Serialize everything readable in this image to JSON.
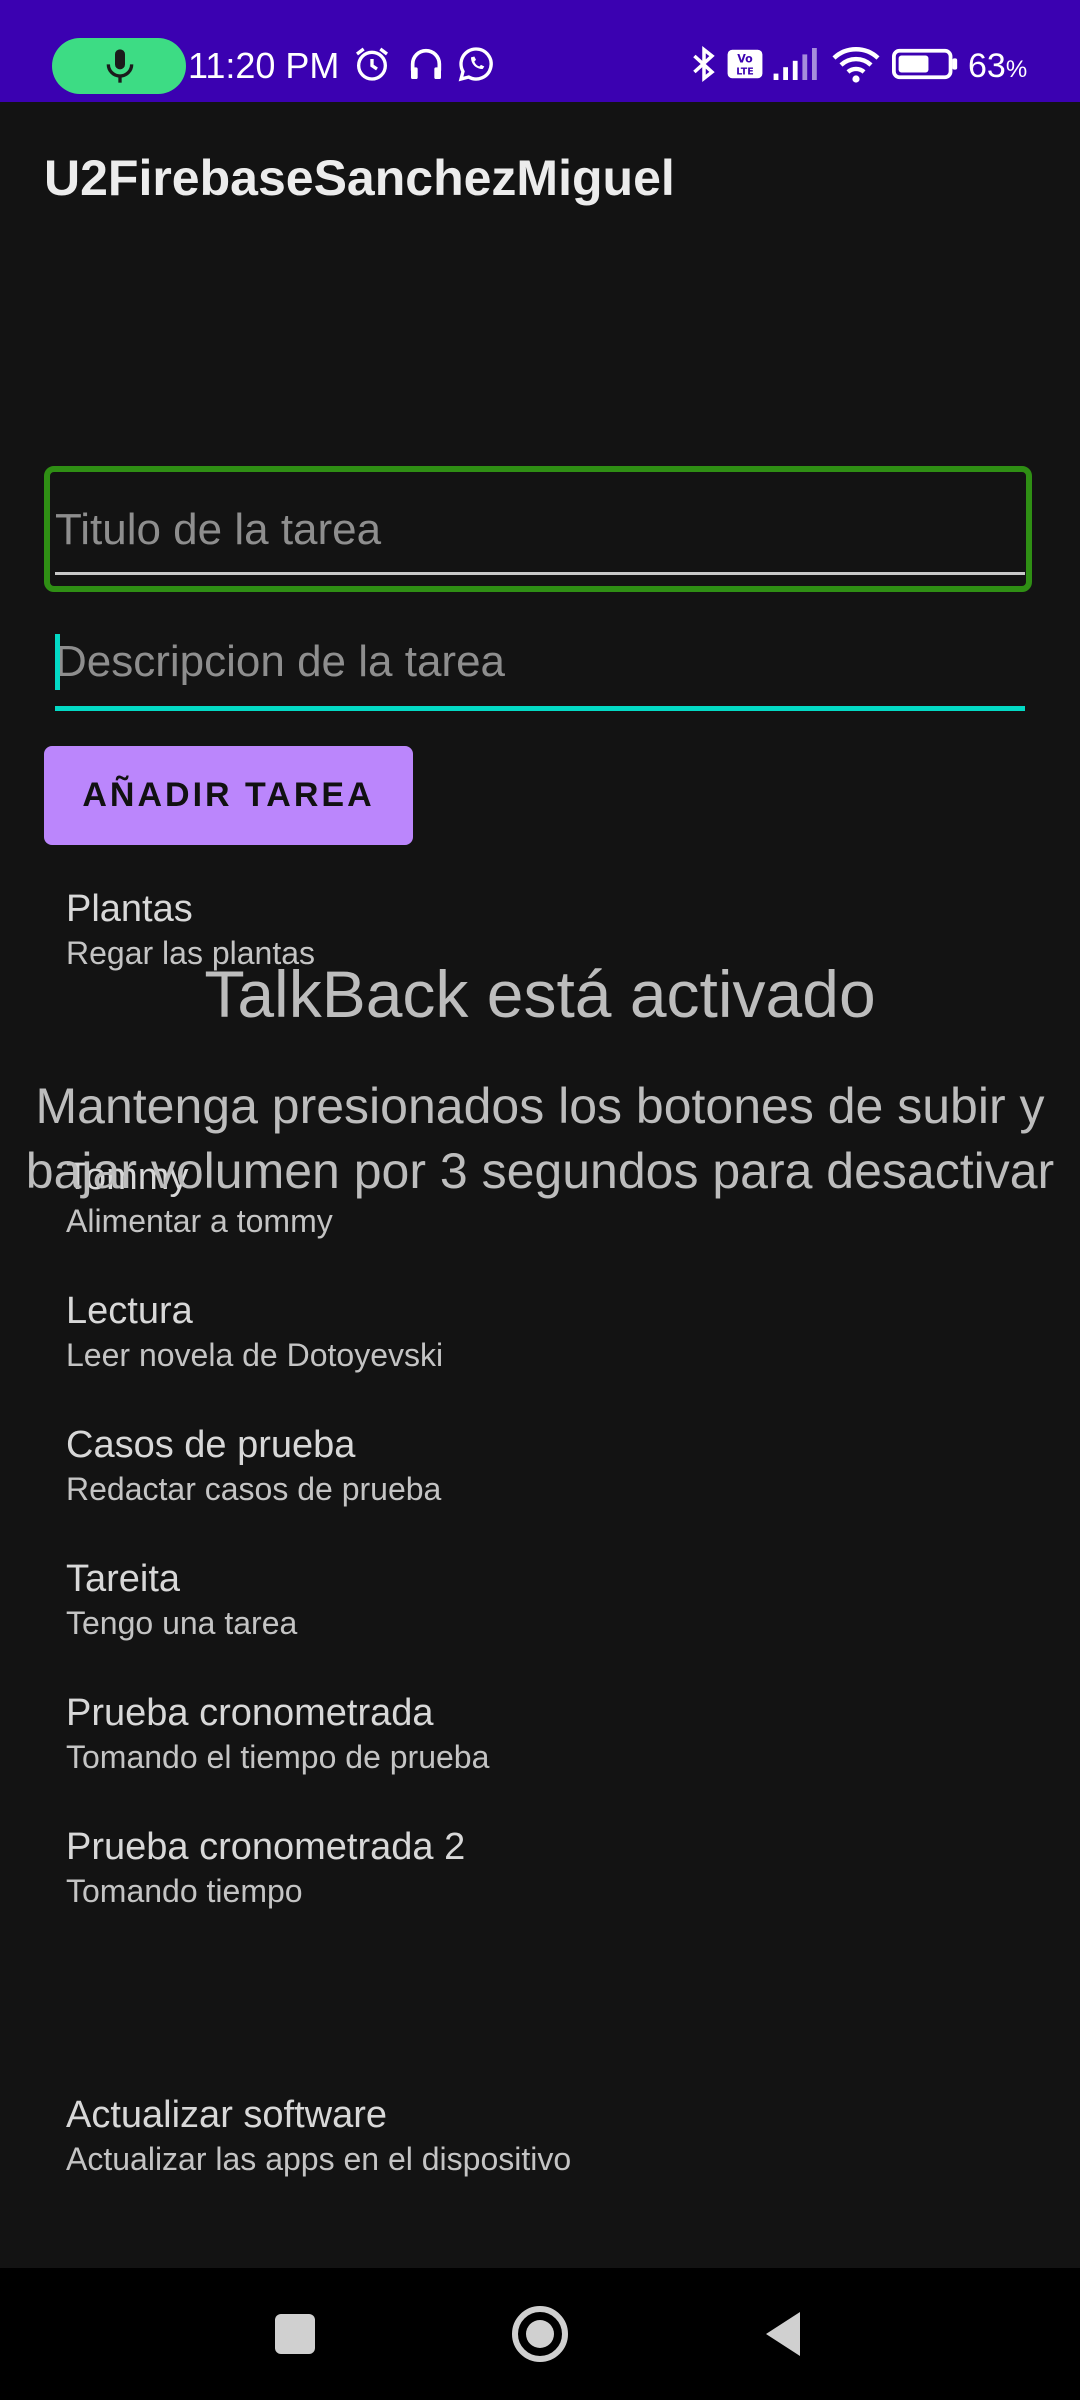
{
  "status_bar": {
    "time": "11:20 PM",
    "battery_percent": "63",
    "battery_unit": "%",
    "network_badge": "Vo LTE",
    "icons": [
      "mic-icon",
      "alarm-icon",
      "headphones-icon",
      "whatsapp-icon",
      "bluetooth-icon",
      "volte-icon",
      "signal-icon",
      "wifi-icon",
      "battery-icon"
    ],
    "bar_color": "#3b01b1",
    "mic_pill_color": "#3ddc84",
    "battery_level": 0.63
  },
  "app_bar": {
    "title": "U2FirebaseSanchezMiguel"
  },
  "form": {
    "title_placeholder": "Titulo de la tarea",
    "title_value": "",
    "description_placeholder": "Descripcion de la tarea",
    "description_value": "",
    "add_button_label": "AÑADIR TAREA",
    "accent_color": "#03dac5",
    "button_color": "#bb86fc",
    "focus_color": "#2f8f14"
  },
  "tasks": [
    {
      "title": "Plantas",
      "description": "Regar las plantas"
    },
    {
      "title": "Tommy",
      "description": "Alimentar a tommy"
    },
    {
      "title": "Lectura",
      "description": "Leer novela de Dotoyevski"
    },
    {
      "title": "Casos de prueba",
      "description": "Redactar casos de prueba"
    },
    {
      "title": "Tareita",
      "description": "Tengo una tarea"
    },
    {
      "title": "Prueba cronometrada",
      "description": "Tomando el tiempo de prueba"
    },
    {
      "title": "Prueba cronometrada 2",
      "description": "Tomando tiempo"
    },
    {
      "title": "Actualizar software",
      "description": "Actualizar las apps en el dispositivo"
    }
  ],
  "talkback": {
    "title": "TalkBack está activado",
    "message": "Mantenga presionados los botones de subir y bajar volumen por 3 segundos para desactivar"
  },
  "nav_bar": {
    "icons": [
      "recents-square-icon",
      "home-circle-icon",
      "back-triangle-icon"
    ]
  }
}
